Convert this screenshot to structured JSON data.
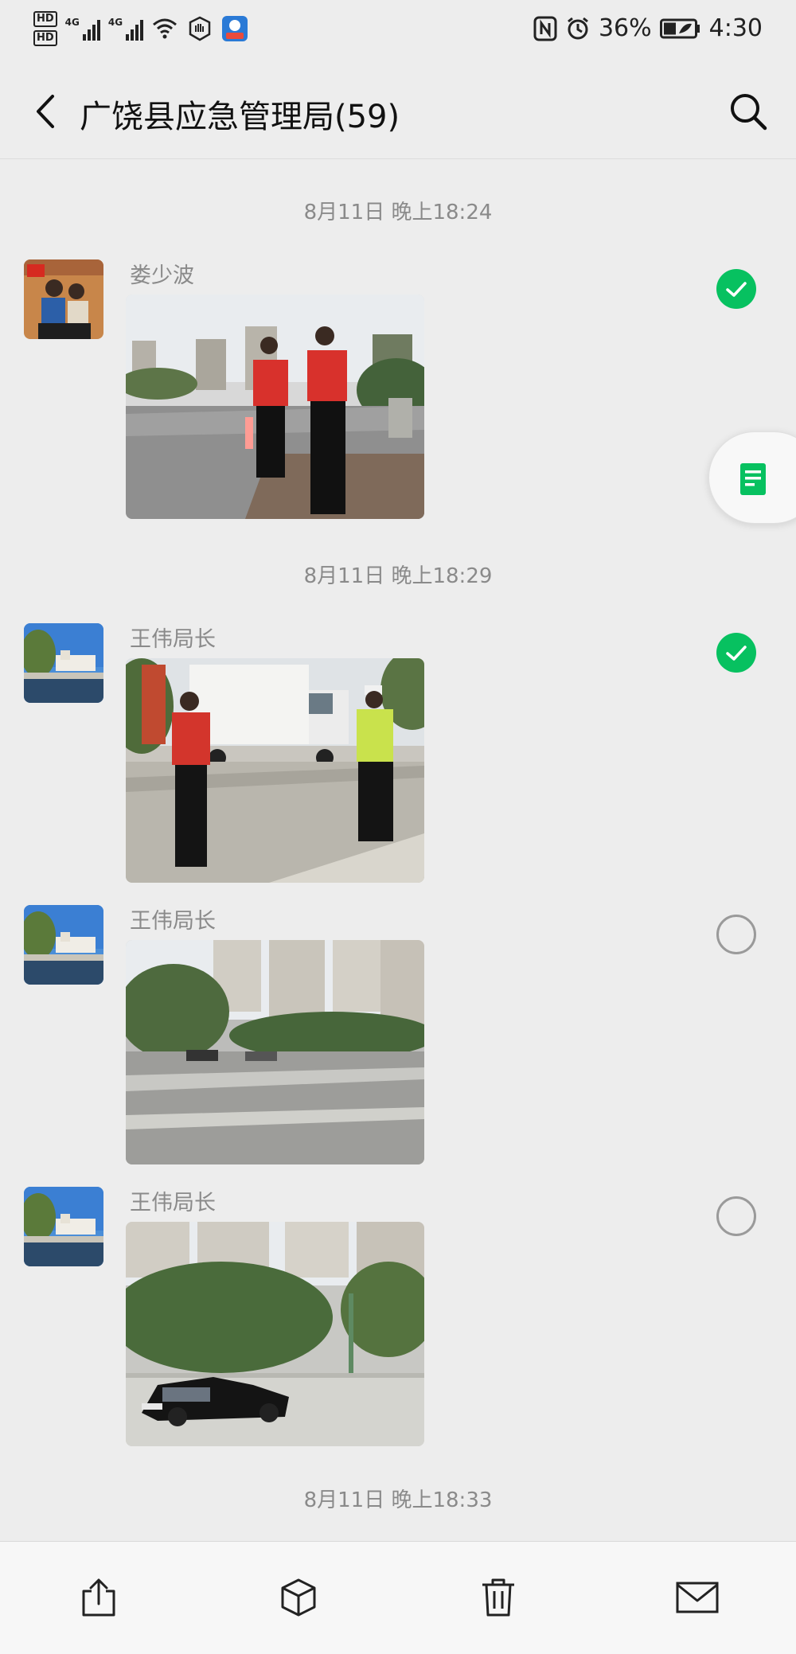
{
  "status_bar": {
    "hd1": "HD",
    "hd2": "HD",
    "sig1_label": "4G",
    "sig2_label": "4G",
    "battery": "36%",
    "time": "4:30"
  },
  "header": {
    "title": "广饶县应急管理局(59)"
  },
  "timestamps": [
    "8月11日 晚上18:24",
    "8月11日 晚上18:29",
    "8月11日 晚上18:33"
  ],
  "messages": [
    {
      "sender": "娄少波",
      "selected": true
    },
    {
      "sender": "王伟局长",
      "selected": true
    },
    {
      "sender": "王伟局长",
      "selected": false
    },
    {
      "sender": "王伟局长",
      "selected": false
    }
  ],
  "icons": {
    "back": "back-arrow-icon",
    "search": "search-icon",
    "float": "document-icon",
    "share": "share-icon",
    "favorite": "cube-icon",
    "delete": "trash-icon",
    "mail": "mail-icon"
  },
  "colors": {
    "accent_green": "#07c160",
    "background": "#ededed"
  }
}
